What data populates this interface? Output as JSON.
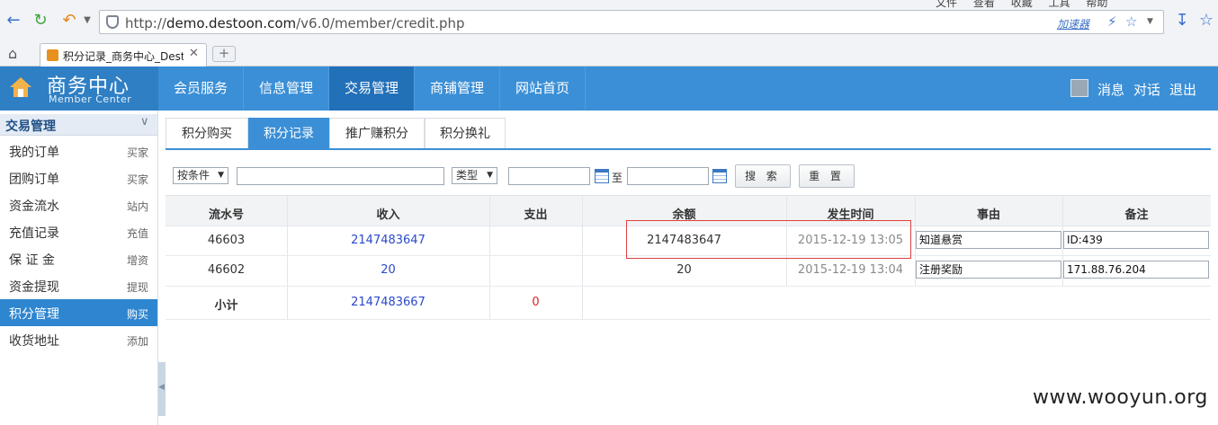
{
  "browser": {
    "menu": [
      "文件",
      "查看",
      "收藏",
      "工具",
      "帮助"
    ],
    "url_prefix": "http://",
    "url_domain": "demo.destoon.com",
    "url_path": "/v6.0/member/credit.php",
    "accelerator_label": "加速器",
    "tab_title": "积分记录_商务中心_Destoon",
    "new_tab_glyph": "+"
  },
  "header": {
    "logo_title": "商务中心",
    "logo_subtitle": "Member Center",
    "nav": [
      {
        "label": "会员服务"
      },
      {
        "label": "信息管理"
      },
      {
        "label": "交易管理",
        "active": true
      },
      {
        "label": "商铺管理"
      },
      {
        "label": "网站首页"
      }
    ],
    "links": [
      "消息",
      "对话",
      "退出"
    ]
  },
  "sidebar": {
    "section_title": "交易管理",
    "items": [
      {
        "label": "我的订单",
        "tag": "买家"
      },
      {
        "label": "团购订单",
        "tag": "买家"
      },
      {
        "label": "资金流水",
        "tag": "站内"
      },
      {
        "label": "充值记录",
        "tag": "充值"
      },
      {
        "label": "保 证 金",
        "tag": "增资"
      },
      {
        "label": "资金提现",
        "tag": "提现"
      },
      {
        "label": "积分管理",
        "tag": "购买",
        "active": true
      },
      {
        "label": "收货地址",
        "tag": "添加"
      }
    ]
  },
  "subtabs": [
    {
      "label": "积分购买"
    },
    {
      "label": "积分记录",
      "active": true
    },
    {
      "label": "推广赚积分"
    },
    {
      "label": "积分换礼"
    }
  ],
  "filters": {
    "condition_select": "按条件",
    "type_select": "类型",
    "to_label": "至",
    "search_button": "搜 索",
    "reset_button": "重 置"
  },
  "table": {
    "headers": [
      "流水号",
      "收入",
      "支出",
      "余额",
      "发生时间",
      "事由",
      "备注"
    ],
    "rows": [
      {
        "id": "46603",
        "income": "2147483647",
        "expense": "",
        "balance": "2147483647",
        "time": "2015-12-19 13:05",
        "reason": "知道悬赏",
        "note": "ID:439"
      },
      {
        "id": "46602",
        "income": "20",
        "expense": "",
        "balance": "20",
        "time": "2015-12-19 13:04",
        "reason": "注册奖励",
        "note": "171.88.76.204"
      }
    ],
    "subtotal_label": "小计",
    "subtotal_income": "2147483667",
    "subtotal_expense": "0"
  },
  "watermark": "www.wooyun.org",
  "colors": {
    "header_blue": "#3b8fd6",
    "active_blue": "#2270b8",
    "income_blue": "#2b49c9",
    "expense_red": "#e02020",
    "highlight_red": "#e04040"
  }
}
